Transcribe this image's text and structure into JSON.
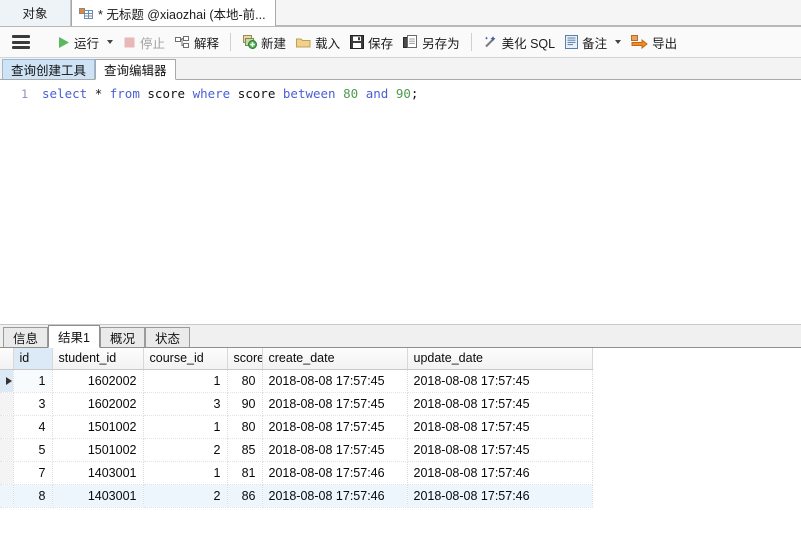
{
  "window": {
    "tabs": [
      {
        "label": "对象",
        "active": false,
        "icon": "object-tab-icon"
      },
      {
        "label": "* 无标题 @xiaozhai (本地-前...",
        "active": true,
        "icon": "query-table-icon"
      }
    ]
  },
  "toolbar": {
    "menu_icon": "hamburger-menu-icon",
    "items": [
      {
        "label": "运行",
        "icon": "play-icon",
        "has_caret": true,
        "disabled": false
      },
      {
        "label": "停止",
        "icon": "stop-icon",
        "has_caret": false,
        "disabled": true
      },
      {
        "label": "解释",
        "icon": "explain-icon",
        "has_caret": false,
        "disabled": false
      },
      {
        "label": "新建",
        "icon": "new-query-icon",
        "has_caret": false,
        "disabled": false
      },
      {
        "label": "载入",
        "icon": "folder-open-icon",
        "has_caret": false,
        "disabled": false
      },
      {
        "label": "保存",
        "icon": "save-disk-icon",
        "has_caret": false,
        "disabled": false
      },
      {
        "label": "另存为",
        "icon": "save-as-icon",
        "has_caret": false,
        "disabled": false
      },
      {
        "label": "美化 SQL",
        "icon": "magic-wand-icon",
        "has_caret": false,
        "disabled": false
      },
      {
        "label": "备注",
        "icon": "note-document-icon",
        "has_caret": true,
        "disabled": false
      },
      {
        "label": "导出",
        "icon": "export-arrow-icon",
        "has_caret": false,
        "disabled": false
      }
    ]
  },
  "editor_tabs": [
    {
      "label": "查询创建工具",
      "active": false
    },
    {
      "label": "查询编辑器",
      "active": true
    }
  ],
  "editor": {
    "line_number": "1",
    "tokens": [
      {
        "text": "select",
        "type": "kw"
      },
      {
        "text": " ",
        "type": "plain"
      },
      {
        "text": "*",
        "type": "op"
      },
      {
        "text": " ",
        "type": "plain"
      },
      {
        "text": "from",
        "type": "kw"
      },
      {
        "text": " ",
        "type": "plain"
      },
      {
        "text": "score",
        "type": "plain"
      },
      {
        "text": " ",
        "type": "plain"
      },
      {
        "text": "where",
        "type": "kw"
      },
      {
        "text": " ",
        "type": "plain"
      },
      {
        "text": "score",
        "type": "plain"
      },
      {
        "text": " ",
        "type": "plain"
      },
      {
        "text": "between",
        "type": "kw"
      },
      {
        "text": " ",
        "type": "plain"
      },
      {
        "text": "80",
        "type": "num"
      },
      {
        "text": " ",
        "type": "plain"
      },
      {
        "text": "and",
        "type": "kw"
      },
      {
        "text": " ",
        "type": "plain"
      },
      {
        "text": "90",
        "type": "num"
      },
      {
        "text": ";",
        "type": "op"
      }
    ],
    "full_text": "select * from score where score between 80 and 90;"
  },
  "result_tabs": [
    {
      "label": "信息",
      "active": false
    },
    {
      "label": "结果1",
      "active": true
    },
    {
      "label": "概况",
      "active": false
    },
    {
      "label": "状态",
      "active": false
    }
  ],
  "result_grid": {
    "columns": [
      "id",
      "student_id",
      "course_id",
      "score",
      "create_date",
      "update_date"
    ],
    "rows": [
      {
        "id": "1",
        "student_id": "1602002",
        "course_id": "1",
        "score": "80",
        "create_date": "2018-08-08 17:57:45",
        "update_date": "2018-08-08 17:57:45",
        "current": true,
        "highlight": false
      },
      {
        "id": "3",
        "student_id": "1602002",
        "course_id": "3",
        "score": "90",
        "create_date": "2018-08-08 17:57:45",
        "update_date": "2018-08-08 17:57:45",
        "current": false,
        "highlight": false
      },
      {
        "id": "4",
        "student_id": "1501002",
        "course_id": "1",
        "score": "80",
        "create_date": "2018-08-08 17:57:45",
        "update_date": "2018-08-08 17:57:45",
        "current": false,
        "highlight": false
      },
      {
        "id": "5",
        "student_id": "1501002",
        "course_id": "2",
        "score": "85",
        "create_date": "2018-08-08 17:57:45",
        "update_date": "2018-08-08 17:57:45",
        "current": false,
        "highlight": false
      },
      {
        "id": "7",
        "student_id": "1403001",
        "course_id": "1",
        "score": "81",
        "create_date": "2018-08-08 17:57:46",
        "update_date": "2018-08-08 17:57:46",
        "current": false,
        "highlight": false
      },
      {
        "id": "8",
        "student_id": "1403001",
        "course_id": "2",
        "score": "86",
        "create_date": "2018-08-08 17:57:46",
        "update_date": "2018-08-08 17:57:46",
        "current": false,
        "highlight": true
      }
    ]
  },
  "colors": {
    "keyword": "#4a5fd4",
    "number": "#4f9b4f",
    "tab_active_bg": "#ffffff",
    "subtab_inactive_bg": "#cfe3f6",
    "grid_selected_header": "#dceaf7",
    "row_highlight": "#eef6fd"
  }
}
